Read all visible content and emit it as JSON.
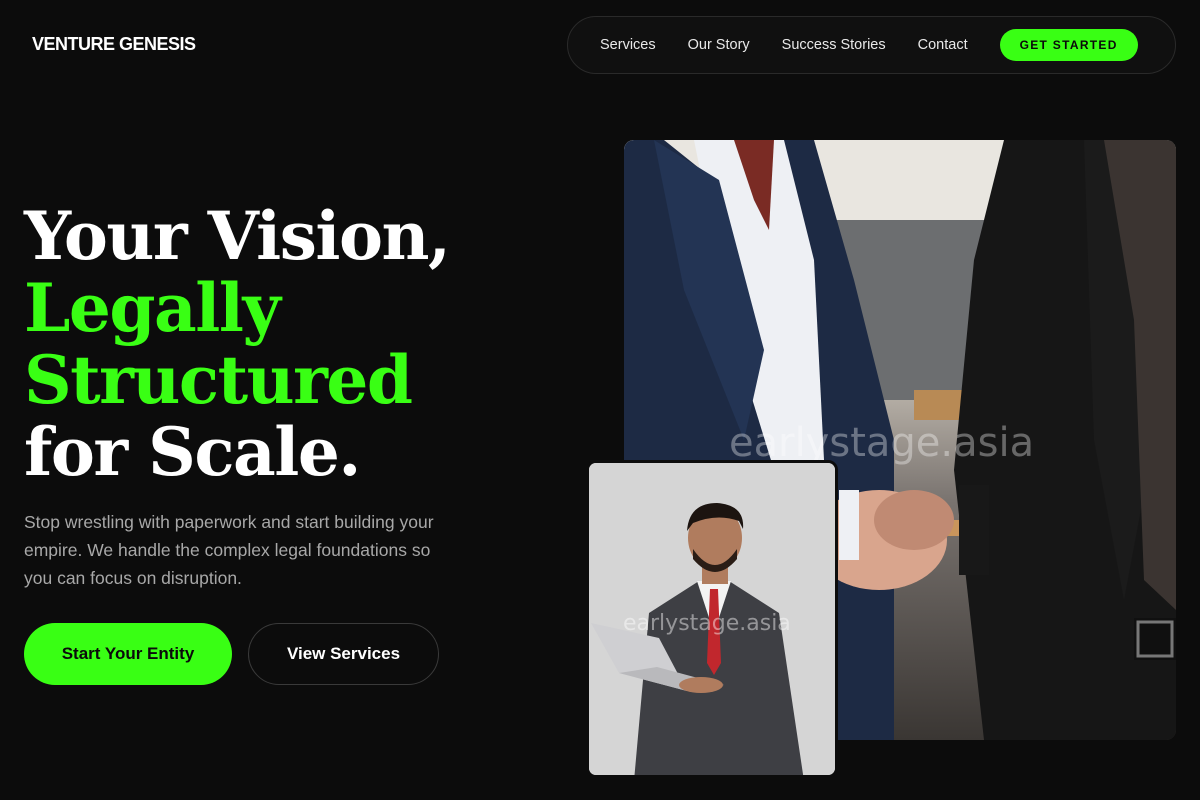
{
  "header": {
    "brand": "VENTURE GENESIS",
    "nav": [
      {
        "label": "Services"
      },
      {
        "label": "Our Story"
      },
      {
        "label": "Success Stories"
      },
      {
        "label": "Contact"
      }
    ],
    "cta_label": "GET STARTED"
  },
  "hero": {
    "headline_line1": "Your Vision,",
    "headline_line2": "Legally",
    "headline_line3": "Structured",
    "headline_line4": "for Scale.",
    "subtext": "Stop wrestling with paperwork and start building your empire. We handle the complex legal foundations so you can focus on disruption.",
    "primary_button": "Start Your Entity",
    "secondary_button": "View Services"
  },
  "images": {
    "main_watermark": "earlystage.asia",
    "small_watermark": "earlystage.asia"
  },
  "colors": {
    "accent": "#39ff14",
    "background": "#0c0c0c"
  }
}
